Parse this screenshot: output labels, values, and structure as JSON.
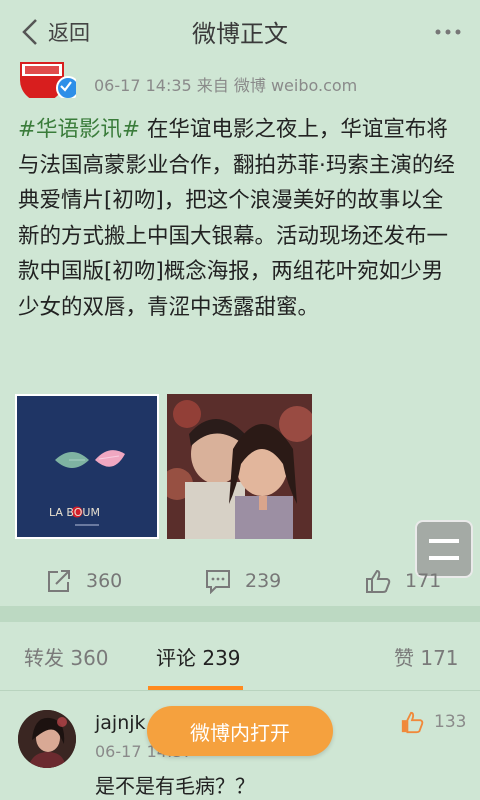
{
  "header": {
    "back_label": "返回",
    "title": "微博正文"
  },
  "post": {
    "meta": "06-17 14:35  来自 微博 weibo.com",
    "hashtag": "#华语影讯#",
    "body": " 在华谊电影之夜上，华谊宣布将与法国高蒙影业合作，翻拍苏菲·玛索主演的经典爱情片[初吻]，把这个浪漫美好的故事以全新的方式搬上中国大银幕。活动现场还发布一款中国版[初吻]概念海报，两组花叶宛如少男少女的双唇，青涩中透露甜蜜。",
    "images": [
      {
        "poster_text": "LA  BOUM"
      },
      {}
    ]
  },
  "actions": {
    "repost_count": "360",
    "comment_count": "239",
    "like_count": "171"
  },
  "tabs": {
    "repost": "转发 360",
    "comment": "评论 239",
    "like": "赞 171"
  },
  "comment": {
    "user": "jajnjk",
    "time": "06-17 14:37",
    "text": "是不是有毛病？？",
    "likes": "133"
  },
  "open_button": "微博内打开",
  "colors": {
    "background": "#cfe6d4",
    "accent": "#ff8a1f",
    "hashtag": "#3a7c3a",
    "open_button": "#f5a13e"
  }
}
